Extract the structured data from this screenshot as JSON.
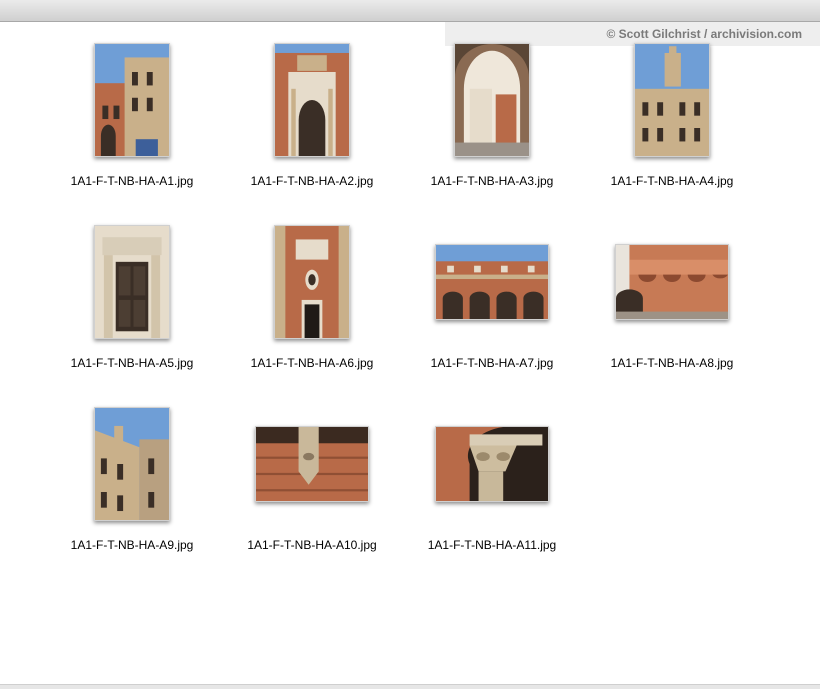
{
  "watermark": "© Scott Gilchrist / archivision.com",
  "files": [
    {
      "name": "1A1-F-T-NB-HA-A1.jpg",
      "orientation": "portrait",
      "thumb_icon": "building-facade-icon"
    },
    {
      "name": "1A1-F-T-NB-HA-A2.jpg",
      "orientation": "portrait",
      "thumb_icon": "ornate-portal-icon"
    },
    {
      "name": "1A1-F-T-NB-HA-A3.jpg",
      "orientation": "portrait",
      "thumb_icon": "archway-icon"
    },
    {
      "name": "1A1-F-T-NB-HA-A4.jpg",
      "orientation": "portrait",
      "thumb_icon": "tower-courtyard-icon"
    },
    {
      "name": "1A1-F-T-NB-HA-A5.jpg",
      "orientation": "portrait",
      "thumb_icon": "doorway-icon"
    },
    {
      "name": "1A1-F-T-NB-HA-A6.jpg",
      "orientation": "portrait",
      "thumb_icon": "window-wall-icon"
    },
    {
      "name": "1A1-F-T-NB-HA-A7.jpg",
      "orientation": "landscape",
      "thumb_icon": "arcade-courtyard-icon"
    },
    {
      "name": "1A1-F-T-NB-HA-A8.jpg",
      "orientation": "landscape",
      "thumb_icon": "brick-arcade-icon"
    },
    {
      "name": "1A1-F-T-NB-HA-A9.jpg",
      "orientation": "portrait",
      "thumb_icon": "courtyard-facade-icon"
    },
    {
      "name": "1A1-F-T-NB-HA-A10.jpg",
      "orientation": "landscape",
      "thumb_icon": "carved-bracket-icon"
    },
    {
      "name": "1A1-F-T-NB-HA-A11.jpg",
      "orientation": "landscape",
      "thumb_icon": "carved-capital-icon"
    }
  ]
}
